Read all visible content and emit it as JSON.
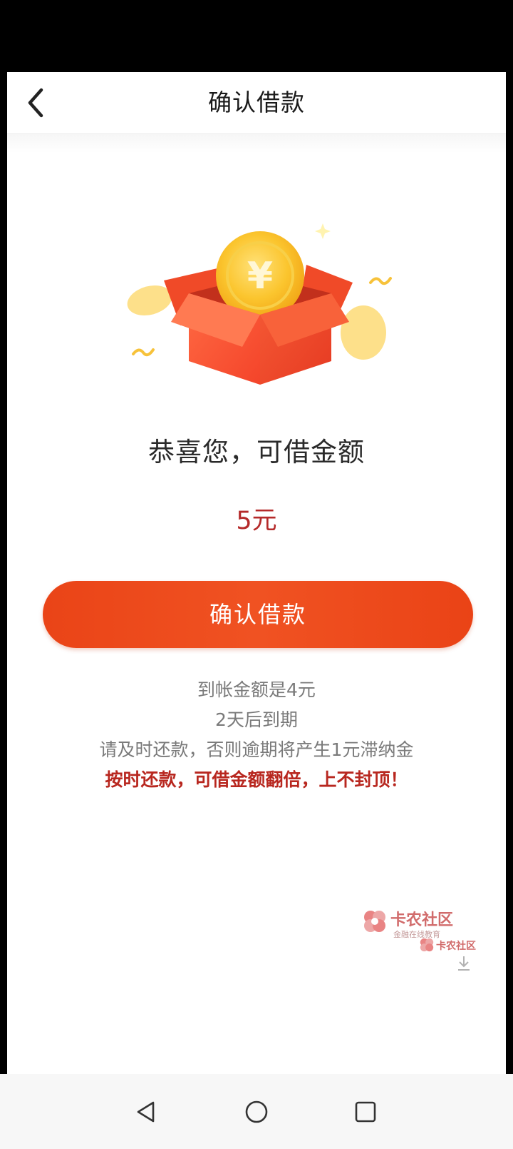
{
  "header": {
    "title": "确认借款",
    "back_icon": "chevron-left-icon"
  },
  "illustration": {
    "icon": "gift-box-coin-icon",
    "coin_symbol": "¥"
  },
  "main": {
    "congrats_text": "恭喜您，可借金额",
    "amount_text": "5元",
    "confirm_button_label": "确认借款",
    "info_lines": [
      "到帐金额是4元",
      "2天后到期",
      "请及时还款，否则逾期将产生1元滞纳金"
    ],
    "highlight_line": "按时还款，可借金额翻倍，上不封顶！"
  },
  "watermark": {
    "name_primary": "卡农社区",
    "tagline_primary": "金融在线教育",
    "name_secondary": "卡农社区"
  },
  "navbar": {
    "back_icon": "triangle-back-icon",
    "home_icon": "circle-home-icon",
    "recents_icon": "square-recents-icon"
  },
  "colors": {
    "accent": "#ed4a1c",
    "amount": "#b52a2a",
    "highlight": "#b8271f",
    "muted_text": "#7a7a7a"
  }
}
